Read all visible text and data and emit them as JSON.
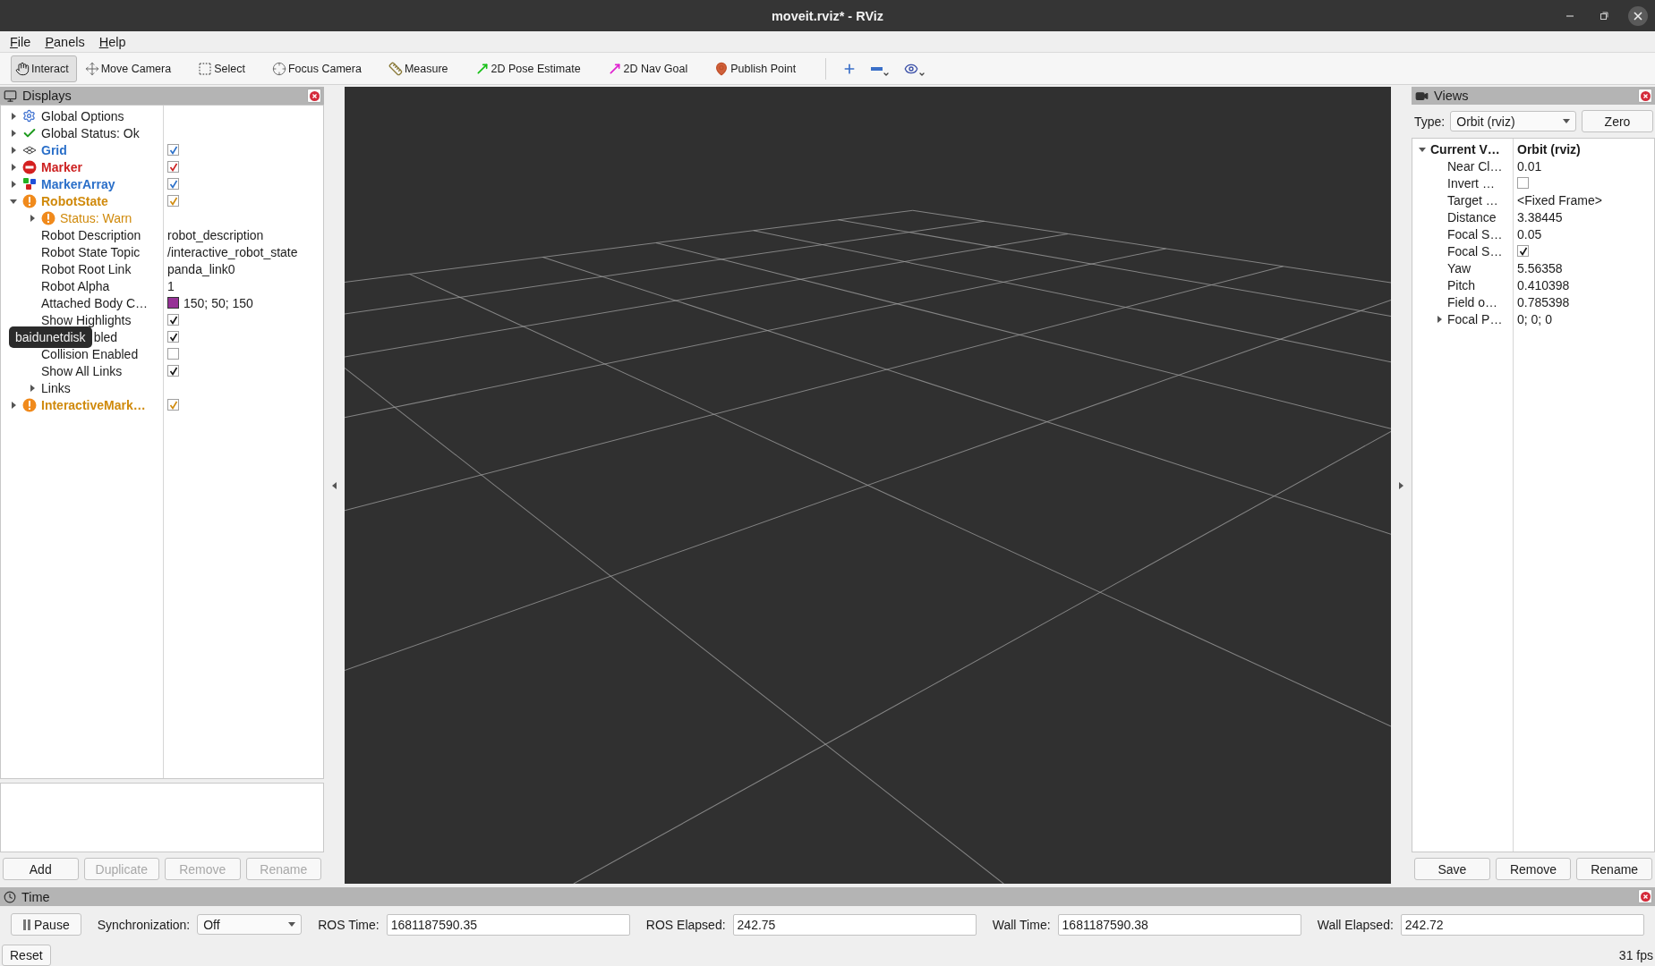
{
  "window": {
    "title": "moveit.rviz* - RViz"
  },
  "menu": [
    {
      "label": "File"
    },
    {
      "label": "Panels"
    },
    {
      "label": "Help"
    }
  ],
  "toolbar": {
    "tools": [
      {
        "label": "Interact",
        "kind": "hand",
        "selected": true
      },
      {
        "label": "Move Camera",
        "kind": "move",
        "selected": false
      },
      {
        "label": "Select",
        "kind": "select",
        "selected": false
      },
      {
        "label": "Focus Camera",
        "kind": "focus",
        "selected": false
      },
      {
        "label": "Measure",
        "kind": "measure",
        "selected": false
      },
      {
        "label": "2D Pose Estimate",
        "kind": "pose",
        "selected": false
      },
      {
        "label": "2D Nav Goal",
        "kind": "goal",
        "selected": false
      },
      {
        "label": "Publish Point",
        "kind": "point",
        "selected": false
      }
    ],
    "view_tools": [
      {
        "kind": "plus"
      },
      {
        "kind": "minus"
      },
      {
        "kind": "eye"
      }
    ]
  },
  "displays": {
    "title": "Displays",
    "items": [
      {
        "label": "Global Options",
        "kind": "options",
        "expanded": false
      },
      {
        "label": "Global Status: Ok",
        "kind": "ok",
        "expanded": false
      },
      {
        "label": "Grid",
        "kind": "grid",
        "expanded": false,
        "checked": true,
        "color": "#2a6fc9"
      },
      {
        "label": "Marker",
        "kind": "error",
        "expanded": false,
        "checked": true,
        "color": "#cc2020"
      },
      {
        "label": "MarkerArray",
        "kind": "markers",
        "expanded": false,
        "checked": true,
        "color": "#2a6fc9"
      },
      {
        "label": "RobotState",
        "kind": "warn",
        "expanded": true,
        "checked": true,
        "color": "#d08a0c",
        "children": [
          {
            "label": "Status: Warn",
            "kind": "warn",
            "expanded": false,
            "color": "#d08a0c"
          },
          {
            "label": "Robot Description",
            "kind": "property",
            "value": "robot_description"
          },
          {
            "label": "Robot State Topic",
            "kind": "property",
            "value": "/interactive_robot_state"
          },
          {
            "label": "Robot Root Link",
            "kind": "property",
            "value": "panda_link0"
          },
          {
            "label": "Robot Alpha",
            "kind": "property",
            "value": "1"
          },
          {
            "label": "Attached Body C…",
            "kind": "property",
            "value": "150; 50; 150",
            "color": "#963296"
          },
          {
            "label": "Show Highlights",
            "kind": "property",
            "checked": true
          },
          {
            "label": "bled",
            "kind": "property",
            "checked": true,
            "tooltip": "baidunetdisk"
          },
          {
            "label": "Collision Enabled",
            "kind": "property",
            "checked": false
          },
          {
            "label": "Show All Links",
            "kind": "property",
            "checked": true
          },
          {
            "label": "Links",
            "kind": "property",
            "expanded": false
          }
        ]
      },
      {
        "label": "InteractiveMark…",
        "kind": "warn",
        "expanded": false,
        "checked": true,
        "color": "#d08a0c"
      }
    ],
    "buttons": [
      {
        "label": "Add",
        "disabled": false
      },
      {
        "label": "Duplicate",
        "disabled": true
      },
      {
        "label": "Remove",
        "disabled": true
      },
      {
        "label": "Rename",
        "disabled": true
      }
    ]
  },
  "views": {
    "title": "Views",
    "type_label": "Type:",
    "type_value": "Orbit (rviz)",
    "zero": "Zero",
    "items": [
      {
        "label": "Current V…",
        "value": "Orbit (rviz)",
        "expanded": true,
        "children": [
          {
            "label": "Near Cl…",
            "value": "0.01"
          },
          {
            "label": "Invert …",
            "checked": false
          },
          {
            "label": "Target …",
            "value": "<Fixed Frame>"
          },
          {
            "label": "Distance",
            "value": "3.38445"
          },
          {
            "label": "Focal S…",
            "value": "0.05"
          },
          {
            "label": "Focal S…",
            "checked": true
          },
          {
            "label": "Yaw",
            "value": "5.56358"
          },
          {
            "label": "Pitch",
            "value": "0.410398"
          },
          {
            "label": "Field o…",
            "value": "0.785398"
          },
          {
            "label": "Focal P…",
            "value": "0; 0; 0",
            "expanded": false
          }
        ]
      }
    ],
    "buttons": [
      {
        "label": "Save"
      },
      {
        "label": "Remove"
      },
      {
        "label": "Rename"
      }
    ]
  },
  "time": {
    "title": "Time",
    "pause": "Pause",
    "sync_label": "Synchronization:",
    "sync_value": "Off",
    "fields": [
      {
        "label": "ROS Time:",
        "value": "1681187590.35"
      },
      {
        "label": "ROS Elapsed:",
        "value": "242.75"
      },
      {
        "label": "Wall Time:",
        "value": "1681187590.38"
      },
      {
        "label": "Wall Elapsed:",
        "value": "242.72"
      }
    ],
    "reset": "Reset",
    "fps": "31 fps"
  }
}
